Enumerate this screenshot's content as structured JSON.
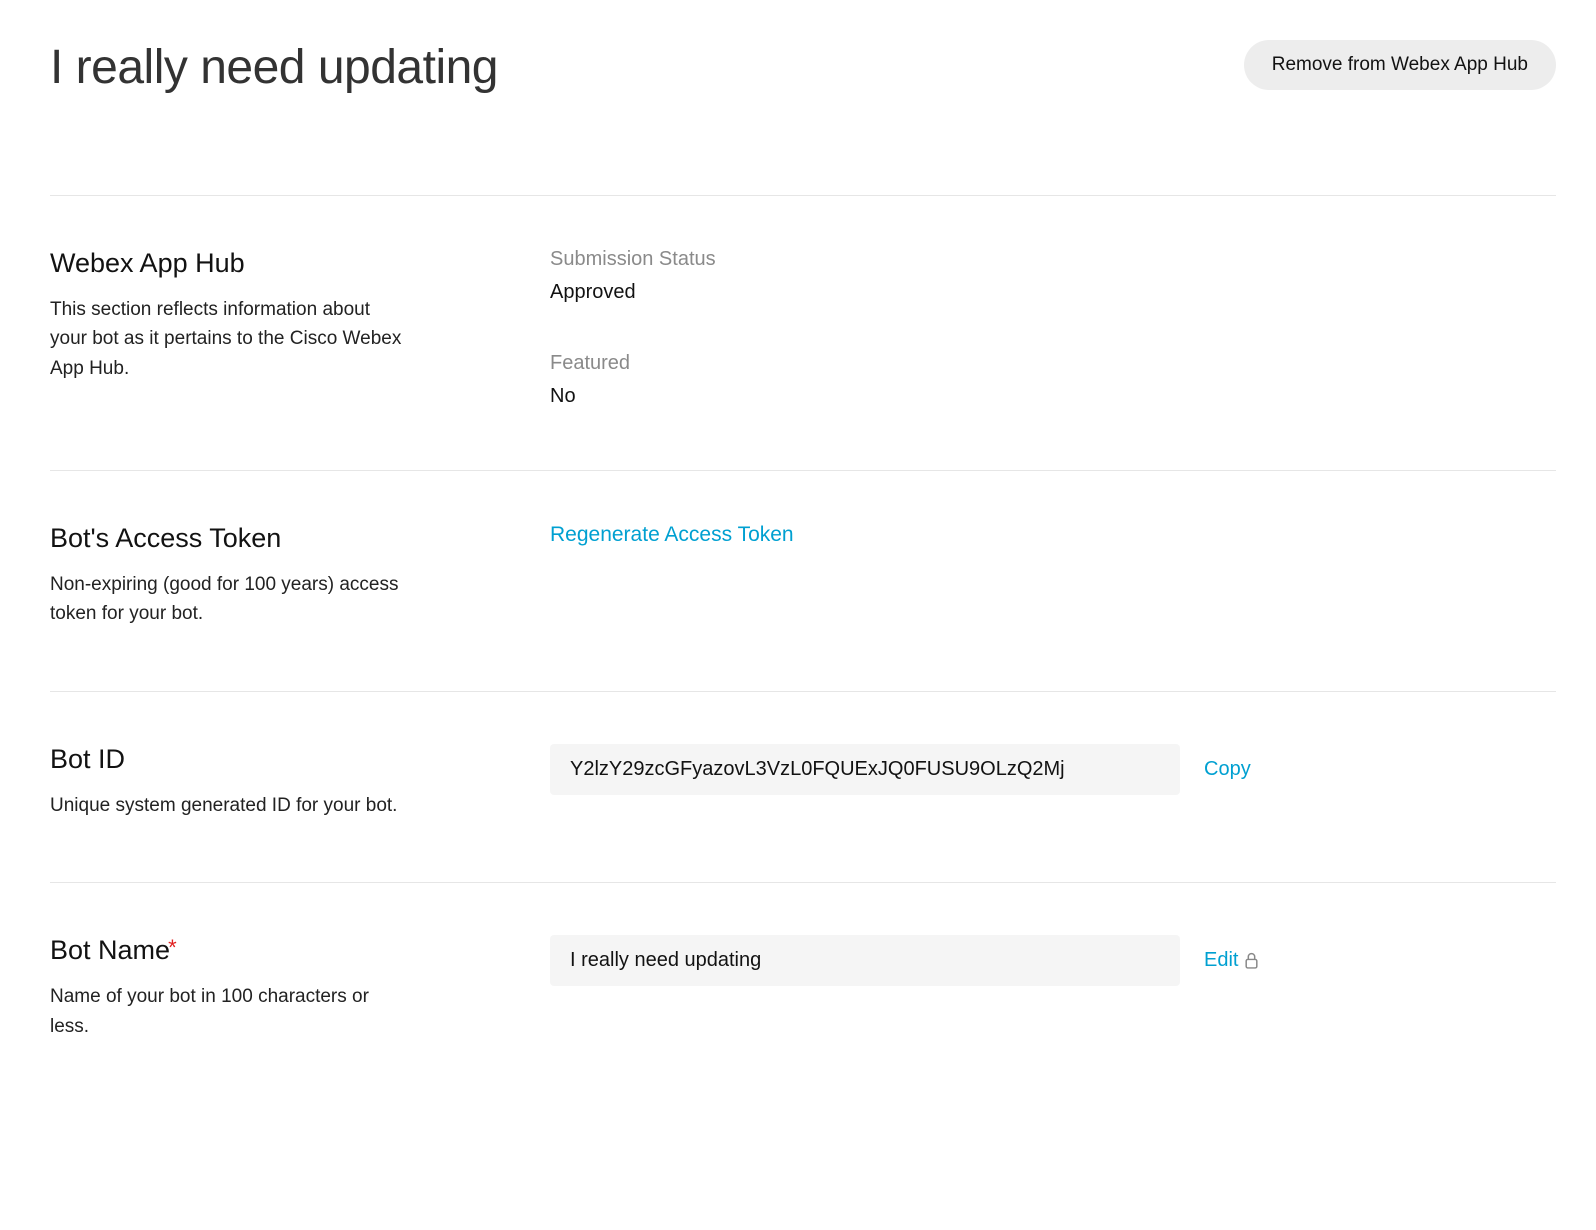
{
  "header": {
    "title": "I really need updating",
    "remove_button": "Remove from Webex App Hub"
  },
  "sections": {
    "apphub": {
      "title": "Webex App Hub",
      "desc": "This section reflects information about your bot as it pertains to the Cisco Webex App Hub.",
      "submission_status_label": "Submission Status",
      "submission_status_value": "Approved",
      "featured_label": "Featured",
      "featured_value": "No"
    },
    "token": {
      "title": "Bot's Access Token",
      "desc": "Non-expiring (good for 100 years) access token for your bot.",
      "regenerate_link": "Regenerate Access Token"
    },
    "botid": {
      "title": "Bot ID",
      "desc": "Unique system generated ID for your bot.",
      "value": "Y2lzY29zcGFyazovL3VzL0FQUExJQ0FUSU9OLzQ2Mj",
      "copy_label": "Copy"
    },
    "botname": {
      "title": "Bot Name",
      "desc": "Name of your bot in 100 characters or less.",
      "value": "I really need updating",
      "edit_label": "Edit"
    }
  }
}
